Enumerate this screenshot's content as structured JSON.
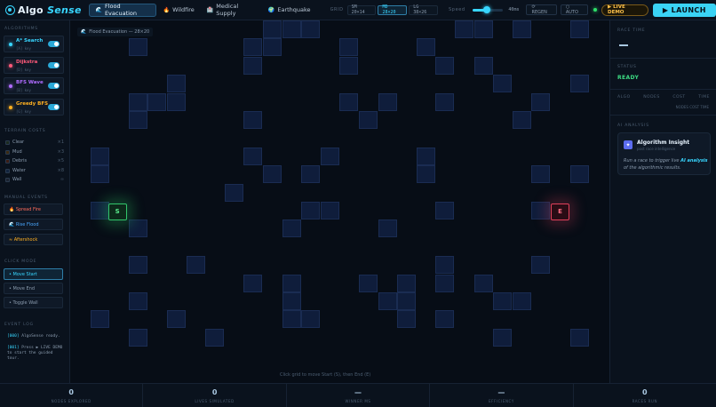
{
  "header": {
    "logo_a": "Algo",
    "logo_b": "Sense",
    "scenarios": [
      {
        "icon": "🌊",
        "label": "Flood Evacuation",
        "active": true
      },
      {
        "icon": "🔥",
        "label": "Wildfire",
        "active": false
      },
      {
        "icon": "🏥",
        "label": "Medical Supply",
        "active": false
      },
      {
        "icon": "🌍",
        "label": "Earthquake",
        "active": false
      }
    ],
    "grid_label": "GRID",
    "grid_sizes": [
      {
        "label": "SM 20×14",
        "active": false
      },
      {
        "label": "MD 28×20",
        "active": true
      },
      {
        "label": "LG 38×26",
        "active": false
      }
    ],
    "speed_label": "Speed",
    "speed_level": 0.45,
    "speed_value": "40ms",
    "regen": "⟳ REGEN",
    "auto": "○ AUTO",
    "live_demo": "▶ LIVE DEMO",
    "launch": "▶ LAUNCH"
  },
  "sidebar": {
    "algorithms_title": "ALGORITHMS",
    "algorithms": [
      {
        "name": "A* Search",
        "sub": "[A] key",
        "color": "#38d6ff"
      },
      {
        "name": "Dijkstra",
        "sub": "[D] key",
        "color": "#ff5a7a"
      },
      {
        "name": "BFS Wave",
        "sub": "[B] key",
        "color": "#b06cff"
      },
      {
        "name": "Greedy BFS",
        "sub": "[G] key",
        "color": "#ffb020"
      }
    ],
    "terrain_title": "TERRAIN COSTS",
    "terrain": [
      {
        "label": "Clear",
        "cost": "×1",
        "color": "#1c2b1f"
      },
      {
        "label": "Mud",
        "cost": "×3",
        "color": "#3a2a12"
      },
      {
        "label": "Debris",
        "cost": "×5",
        "color": "#3a1c14"
      },
      {
        "label": "Water",
        "cost": "×8",
        "color": "#12243f"
      },
      {
        "label": "Wall",
        "cost": "∞",
        "color": "#1c2230"
      }
    ],
    "events_title": "MANUAL EVENTS",
    "events": [
      {
        "label": "🔥 Spread Fire",
        "color": "#ff6b5a"
      },
      {
        "label": "🌊 Rise Flood",
        "color": "#4aa8ff"
      },
      {
        "label": "≈ Aftershock",
        "color": "#ffb020"
      }
    ],
    "mode_title": "CLICK MODE",
    "modes": [
      {
        "label": "• Move Start",
        "active": true
      },
      {
        "label": "• Move End",
        "active": false
      },
      {
        "label": "• Toggle Wall",
        "active": false
      }
    ],
    "log_title": "EVENT LOG",
    "log": [
      {
        "ts": "[000]",
        "text": "AlgoSense ready."
      },
      {
        "ts": "[001]",
        "text": "Press ▶ LIVE DEMO to start the guided tour."
      }
    ]
  },
  "grid": {
    "title_icon": "🌊",
    "title": "Flood Evacuation — 28×20",
    "start_label": "S",
    "end_label": "E",
    "hint": "Click grid to move Start (S), then End (E)"
  },
  "right": {
    "race_title": "RACE TIME",
    "status_title": "STATUS",
    "status": "READY",
    "cols": [
      "ALGO",
      "NODES",
      "COST",
      "TIME"
    ],
    "subcol": "NODES COST TIME",
    "ai_title": "AI ANALYSIS",
    "insight_icon": "✦",
    "insight_title": "Algorithm Insight",
    "insight_sub": "post race intelligence",
    "insight_pre": "Run a race to trigger live ",
    "insight_bold": "AI analysis",
    "insight_post": " of the algorithmic results."
  },
  "stats": [
    {
      "value": "0",
      "label": "NODES EXPLORED"
    },
    {
      "value": "0",
      "label": "LIVES SIMULATED"
    },
    {
      "value": "—",
      "label": "WINNER MS"
    },
    {
      "value": "—",
      "label": "EFFICIENCY"
    },
    {
      "value": "0",
      "label": "RACES RUN"
    }
  ],
  "wall_cells": [
    [
      10,
      0
    ],
    [
      11,
      0
    ],
    [
      12,
      0
    ],
    [
      20,
      0
    ],
    [
      21,
      0
    ],
    [
      23,
      0
    ],
    [
      26,
      0
    ],
    [
      3,
      1
    ],
    [
      9,
      1
    ],
    [
      10,
      1
    ],
    [
      14,
      1
    ],
    [
      18,
      1
    ],
    [
      9,
      2
    ],
    [
      14,
      2
    ],
    [
      19,
      2
    ],
    [
      21,
      2
    ],
    [
      5,
      3
    ],
    [
      22,
      3
    ],
    [
      26,
      3
    ],
    [
      3,
      4
    ],
    [
      4,
      4
    ],
    [
      5,
      4
    ],
    [
      14,
      4
    ],
    [
      16,
      4
    ],
    [
      19,
      4
    ],
    [
      24,
      4
    ],
    [
      3,
      5
    ],
    [
      9,
      5
    ],
    [
      15,
      5
    ],
    [
      23,
      5
    ],
    [
      1,
      7
    ],
    [
      9,
      7
    ],
    [
      13,
      7
    ],
    [
      18,
      7
    ],
    [
      1,
      8
    ],
    [
      10,
      8
    ],
    [
      12,
      8
    ],
    [
      18,
      8
    ],
    [
      24,
      8
    ],
    [
      26,
      8
    ],
    [
      8,
      9
    ],
    [
      1,
      10
    ],
    [
      12,
      10
    ],
    [
      13,
      10
    ],
    [
      19,
      10
    ],
    [
      24,
      10
    ],
    [
      3,
      11
    ],
    [
      11,
      11
    ],
    [
      16,
      11
    ],
    [
      3,
      13
    ],
    [
      6,
      13
    ],
    [
      19,
      13
    ],
    [
      24,
      13
    ],
    [
      9,
      14
    ],
    [
      11,
      14
    ],
    [
      15,
      14
    ],
    [
      17,
      14
    ],
    [
      19,
      14
    ],
    [
      21,
      14
    ],
    [
      3,
      15
    ],
    [
      11,
      15
    ],
    [
      16,
      15
    ],
    [
      17,
      15
    ],
    [
      22,
      15
    ],
    [
      23,
      15
    ],
    [
      1,
      16
    ],
    [
      5,
      16
    ],
    [
      11,
      16
    ],
    [
      12,
      16
    ],
    [
      17,
      16
    ],
    [
      19,
      16
    ],
    [
      3,
      17
    ],
    [
      7,
      17
    ],
    [
      22,
      17
    ],
    [
      26,
      17
    ]
  ],
  "start_cell": [
    1,
    9
  ],
  "end_cell": [
    25,
    9
  ]
}
